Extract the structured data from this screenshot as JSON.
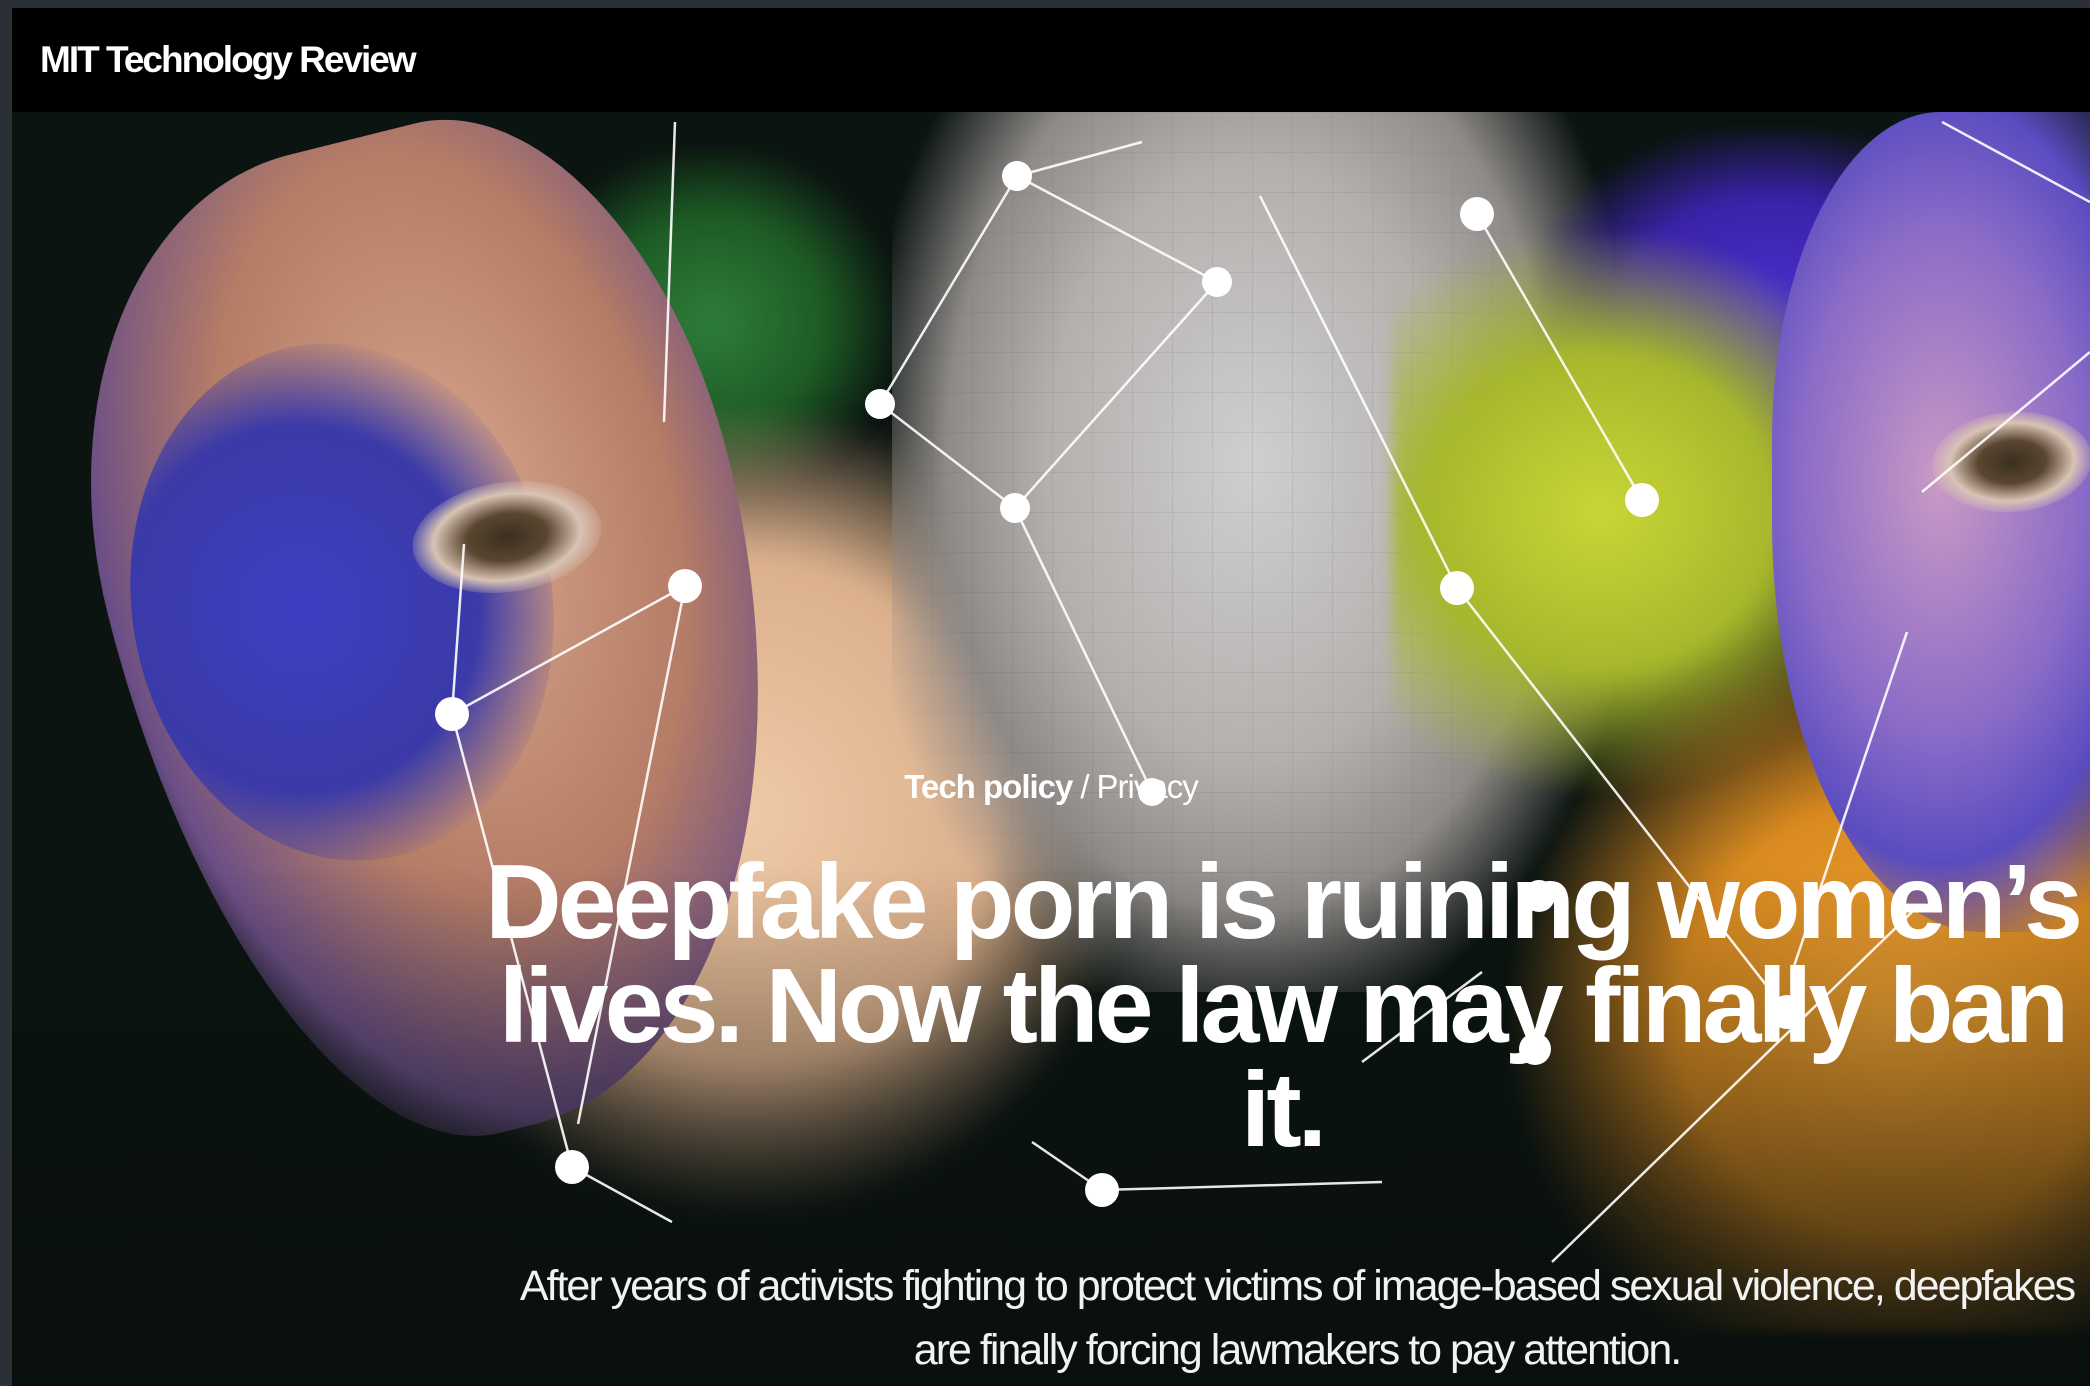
{
  "header": {
    "brand": "MIT Technology Review"
  },
  "article": {
    "category_primary": "Tech policy",
    "category_separator": "/",
    "category_secondary": "Privacy",
    "headline": "Deepfake porn is ruining women’s lives. Now the law may finally ban it.",
    "dek": "After years of activists fighting to protect victims of image-based sexual violence, deepfakes are finally forcing lawmakers to pay attention."
  },
  "colors": {
    "header_bg": "#000000",
    "hero_bg": "#0b1411",
    "text": "#ffffff"
  }
}
